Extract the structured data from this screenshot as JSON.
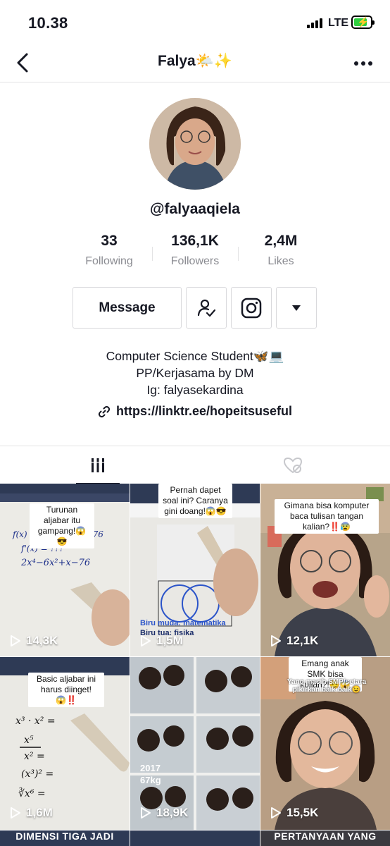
{
  "status": {
    "time": "10.38",
    "network": "LTE"
  },
  "nav": {
    "title": "Falya🌤️✨"
  },
  "profile": {
    "username": "@falyaaqiela",
    "stats": [
      {
        "value": "33",
        "label": "Following"
      },
      {
        "value": "136,1K",
        "label": "Followers"
      },
      {
        "value": "2,4M",
        "label": "Likes"
      }
    ],
    "message_label": "Message",
    "bio": [
      "Computer Science Student🦋💻",
      "PP/Kerjasama by DM",
      "Ig: falyasekardina"
    ],
    "link": "https://linktr.ee/hopeitsuseful"
  },
  "videos": [
    {
      "views": "14,3K",
      "caption": "Turunan aljabar itu gampang!😱😎"
    },
    {
      "views": "1,5M",
      "caption": "Pernah dapet soal ini? Caranya gini doang!😱😎",
      "overlay1": "Biru muda: matematika",
      "overlay2": "Biru tua: fisika"
    },
    {
      "views": "12,1K",
      "caption": "Gimana bisa komputer baca tulisan tangan kalian?‼️😰"
    },
    {
      "views": "1,6M",
      "caption": "Basic aljabar ini harus diinget!😱‼️",
      "bottom": "DIMENSI TIGA JADI"
    },
    {
      "views": "18,9K",
      "overlay1": "2017",
      "overlay2": "67kg"
    },
    {
      "views": "15,5K",
      "caption": "Emang anak SMK bisa kuliah?!😏😱",
      "subcaption": "Yang masih SMP/setara pikirkan baik baik😉",
      "bottom": "PERTANYAAN YANG"
    }
  ],
  "colors": {
    "accent": "#161823",
    "muted": "#8a8b91",
    "battery": "#2fcf3f"
  }
}
